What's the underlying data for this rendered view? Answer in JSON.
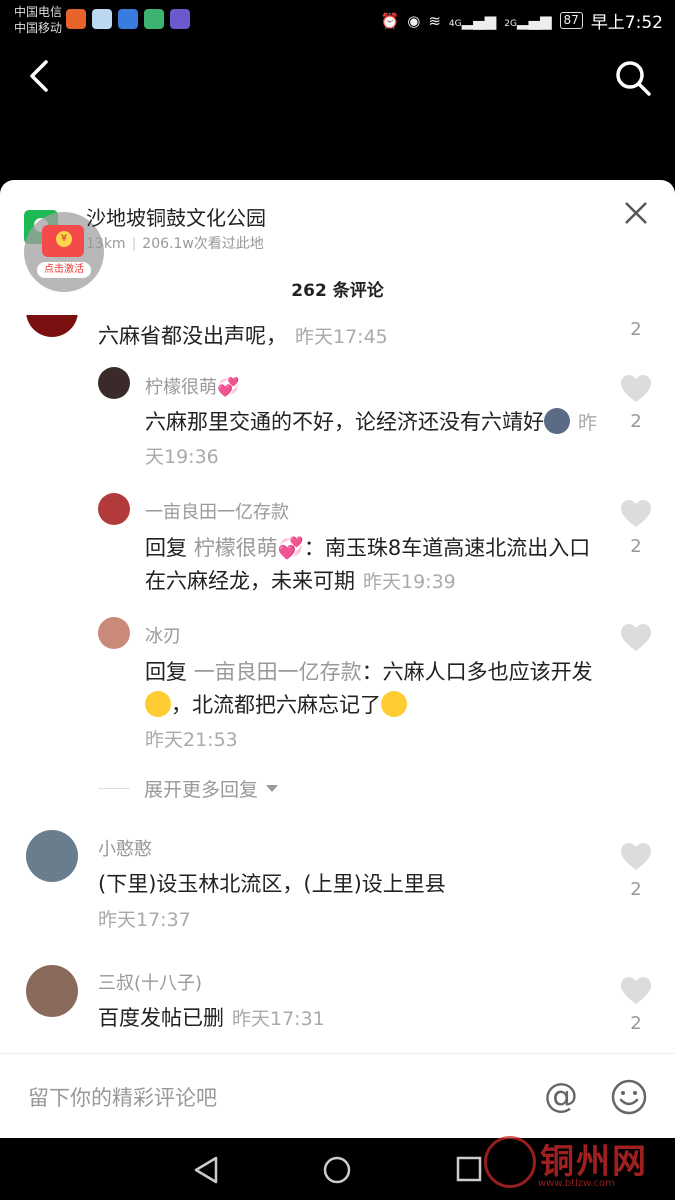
{
  "status_bar": {
    "carrier1": "中国电信",
    "carrier2": "中国移动",
    "battery": "87",
    "time": "早上7:52",
    "signal1": "4G",
    "signal2": "2G"
  },
  "location": {
    "title": "沙地坡铜鼓文化公园",
    "distance": "13km",
    "views": "206.1w次看过此地",
    "redpacket_label": "点击激活",
    "redpacket_symbol": "¥"
  },
  "comment_header": "262 条评论",
  "comments": [
    {
      "text": "六麻省都没出声呢，",
      "time": "昨天17:45",
      "likes": "2"
    },
    {
      "name": "柠檬很萌💞",
      "text": "六麻那里交通的不好，论经济还没有六靖好",
      "time": "昨天19:36",
      "likes": "2"
    },
    {
      "name": "一亩良田一亿存款",
      "reply_prefix": "回复 ",
      "reply_to": "柠檬很萌💞",
      "text": "：南玉珠8车道高速北流出入口在六麻经龙，未来可期",
      "time": "昨天19:39",
      "likes": "2"
    },
    {
      "name": "冰刃",
      "reply_prefix": "回复 ",
      "reply_to": "一亩良田一亿存款",
      "text_a": "：六麻人口多也应该开发",
      "text_b": "，北流都把六麻忘记了",
      "time": "昨天21:53"
    },
    {
      "name": "小憨憨",
      "text": "(下里)设玉林北流区，(上里)设上里县",
      "time": "昨天17:37",
      "likes": "2"
    },
    {
      "name": "三叔(十八子)",
      "text": "百度发帖已删",
      "time": "昨天17:31",
      "likes": "2"
    }
  ],
  "expand_more": "展开更多回复",
  "input": {
    "placeholder": "留下你的精彩评论吧",
    "at": "@"
  },
  "watermark": {
    "text": "铜州网",
    "sub": "www.btlzw.com"
  },
  "icons": {
    "back": "back-arrow-icon",
    "search": "search-icon",
    "close": "close-icon",
    "heart": "heart-icon",
    "emoji": "emoji-icon"
  },
  "colors": {
    "like_heart": "#dcdcdc",
    "muted": "#999999",
    "location_green": "#1db954",
    "redpacket": "#f44a4a"
  }
}
